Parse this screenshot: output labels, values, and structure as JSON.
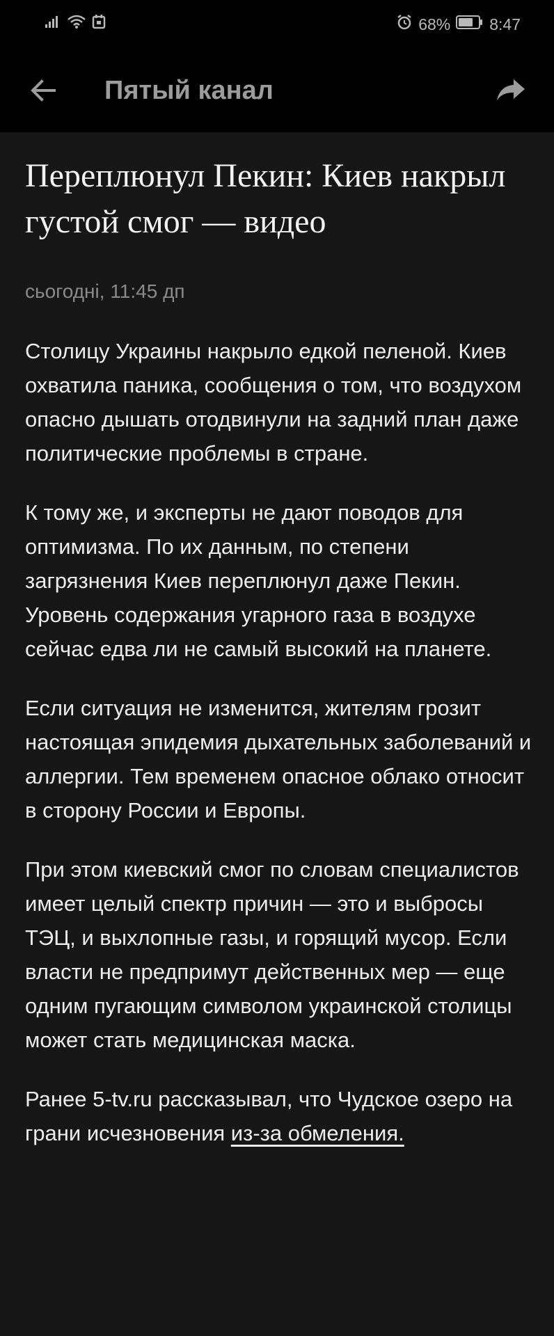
{
  "status_bar": {
    "battery_percent": "68%",
    "time": "8:47",
    "icons": [
      "signal-icon",
      "wifi-icon",
      "calendar-notification-icon",
      "alarm-icon",
      "battery-icon"
    ]
  },
  "app_bar": {
    "title": "Пятый канал",
    "back_icon": "arrow-left-icon",
    "share_icon": "share-arrow-icon"
  },
  "article": {
    "headline": "Переплюнул Пекин: Киев накрыл густой смог — видео",
    "date": "сьогодні, 11:45 дп",
    "paragraphs": [
      "Столицу Украины накрыло едкой пеленой. Киев охватила паника, сообщения о том, что воздухом опасно дышать отодвинули на задний план даже политические проблемы в стране.",
      "К тому же, и эксперты не дают поводов для оптимизма. По их данным, по степени загрязнения Киев переплюнул даже Пекин. Уровень содержания угарного газа в воздухе сейчас едва ли не самый высокий на планете.",
      "Если ситуация не изменится, жителям грозит настоящая эпидемия дыхательных заболеваний и аллергии. Тем временем опасное облако относит в сторону России и Европы.",
      "При этом киевский смог по словам специалистов имеет целый спектр причин — это и выбросы ТЭЦ, и выхлопные газы, и  горящий мусор. Если власти не предпримут действенных мер — еще одним пугающим символом украинской столицы может стать медицинская маска."
    ],
    "last_paragraph_text": "Ранее 5-tv.ru рассказывал, что Чудское озеро на грани исчезновения ",
    "last_paragraph_link": "из-за обмеления."
  }
}
